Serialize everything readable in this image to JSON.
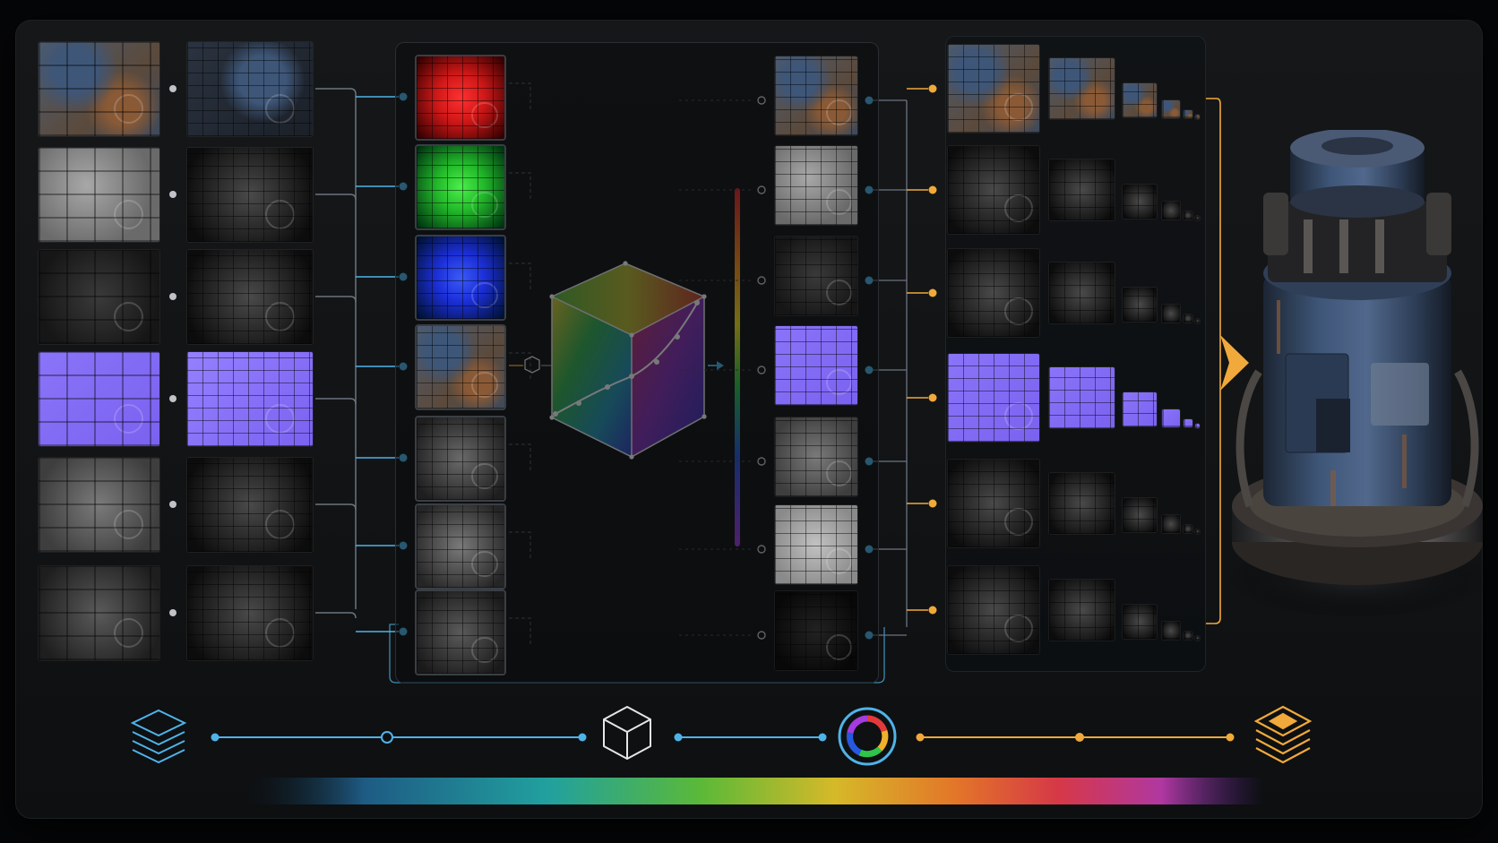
{
  "colors": {
    "background": "#050607",
    "panel": "#131517",
    "blue_link": "#4fb3e8",
    "orange_link": "#f0a93a",
    "normal_map": "#7a62f0",
    "red_channel": "#d01818",
    "green_channel": "#22b82a",
    "blue_channel": "#1c2fd8",
    "rust": "#8a5a36",
    "steel_blue": "#3e5678"
  },
  "pipeline": {
    "input_rows": [
      {
        "kind": "albedo"
      },
      {
        "kind": "roughness"
      },
      {
        "kind": "metallic"
      },
      {
        "kind": "normal"
      },
      {
        "kind": "height"
      },
      {
        "kind": "ambient-occlusion"
      }
    ],
    "channel_tiles": [
      {
        "kind": "red-channel"
      },
      {
        "kind": "green-channel"
      },
      {
        "kind": "blue-channel"
      },
      {
        "kind": "albedo"
      },
      {
        "kind": "grayscale-a"
      },
      {
        "kind": "grayscale-b"
      },
      {
        "kind": "grayscale-c"
      }
    ],
    "output_tiles": [
      {
        "kind": "albedo"
      },
      {
        "kind": "roughness"
      },
      {
        "kind": "metallic"
      },
      {
        "kind": "normal"
      },
      {
        "kind": "height"
      },
      {
        "kind": "specular"
      },
      {
        "kind": "emissive"
      }
    ],
    "mip_rows": [
      {
        "kind": "albedo"
      },
      {
        "kind": "roughness"
      },
      {
        "kind": "metallic"
      },
      {
        "kind": "normal"
      },
      {
        "kind": "height"
      },
      {
        "kind": "ambient-occlusion"
      }
    ]
  },
  "icons": {
    "layers_input": "layers-stack-icon",
    "cube": "cube-icon",
    "color_wheel": "color-wheel-icon",
    "layers_output": "layers-stack-gold-icon",
    "lut_cube": "color-lut-cube-icon",
    "arrow": "chevron-right-icon",
    "render": "rusted-cylinder-render"
  }
}
